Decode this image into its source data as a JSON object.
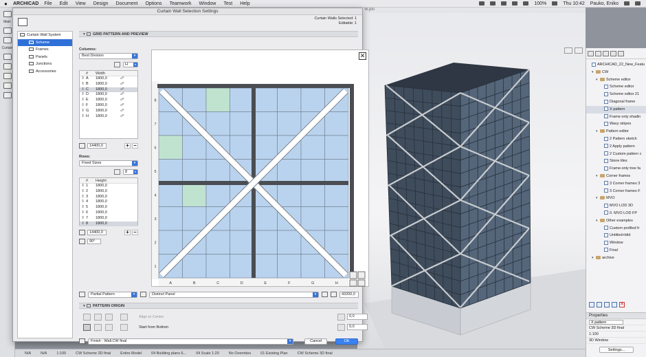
{
  "menubar": {
    "app": "ARCHICAD",
    "items": [
      "File",
      "Edit",
      "View",
      "Design",
      "Document",
      "Options",
      "Teamwork",
      "Window",
      "Test",
      "Help"
    ],
    "status_pct": "100%",
    "clock": "Thu 10:42",
    "user": "Pauko, Eniko"
  },
  "left_toolbar": {
    "main_label": "Main",
    "curtain_label": "Curtain"
  },
  "viewport": {
    "tab_title": "W.pln"
  },
  "dialog": {
    "title": "Curtain Wall Selection Settings",
    "selected_line1": "Curtain Walls Selected: 1",
    "selected_line2": "Editable: 1",
    "tree": {
      "root": "Curtain Wall System",
      "items": [
        "Scheme",
        "Frames",
        "Panels",
        "Junctions",
        "Accessories"
      ],
      "selected_index": 0
    },
    "grid_section": "GRID PATTERN AND PREVIEW",
    "columns": {
      "label": "Columns:",
      "mode": "Best Division",
      "h_option": "H",
      "header_hash": "#",
      "header_width": "Width",
      "rows": [
        {
          "id": "A",
          "value": "1800,0"
        },
        {
          "id": "B",
          "value": "1800,0"
        },
        {
          "id": "C",
          "value": "1800,0"
        },
        {
          "id": "D",
          "value": "1800,0"
        },
        {
          "id": "E",
          "value": "1800,0"
        },
        {
          "id": "F",
          "value": "1800,0"
        },
        {
          "id": "G",
          "value": "1800,0"
        },
        {
          "id": "H",
          "value": "1800,0"
        }
      ],
      "selected_index": 2,
      "total": "14400,0"
    },
    "rows": {
      "label": "Rows:",
      "mode": "Fixed Sizes",
      "count_option": "8",
      "header_hash": "#",
      "header_height": "Height",
      "rows": [
        {
          "id": "1",
          "value": "1800,0"
        },
        {
          "id": "2",
          "value": "1800,0"
        },
        {
          "id": "3",
          "value": "1800,0"
        },
        {
          "id": "4",
          "value": "1800,0"
        },
        {
          "id": "5",
          "value": "1800,0"
        },
        {
          "id": "6",
          "value": "1800,0"
        },
        {
          "id": "7",
          "value": "1800,0"
        },
        {
          "id": "8",
          "value": "1800,0"
        }
      ],
      "selected_index": 7,
      "total": "14400,0",
      "angle": "90°"
    },
    "preview": {
      "col_labels": [
        "A",
        "B",
        "C",
        "D",
        "E",
        "F",
        "G",
        "H"
      ],
      "row_labels": [
        "1",
        "2",
        "3",
        "4",
        "5",
        "6",
        "7",
        "8"
      ]
    },
    "pattern_mode": "Partial Pattern",
    "panel_mode": "Distinct Panel",
    "pattern_width": "43200,0",
    "origin_section": "PATTERN ORIGIN",
    "align_center": "Align to Center",
    "start_bottom": "Start from Bottom",
    "origin_x": "0,0",
    "origin_y": "0,0",
    "footer_favorite": "Finish - Wall.CW final",
    "cancel": "Cancel",
    "ok": "OK"
  },
  "navigator": {
    "items": [
      {
        "level": 0,
        "type": "view",
        "label": "ARCHICAD_22_New_Featu"
      },
      {
        "level": 1,
        "type": "folder",
        "label": "CW"
      },
      {
        "level": 2,
        "type": "folder",
        "label": "Scheme editor"
      },
      {
        "level": 3,
        "type": "view",
        "label": "Scheme editor"
      },
      {
        "level": 3,
        "type": "view",
        "label": "Scheme editor 21"
      },
      {
        "level": 3,
        "type": "view",
        "label": "Diagonal frame"
      },
      {
        "level": 3,
        "type": "view",
        "label": "X pattern",
        "selected": true
      },
      {
        "level": 3,
        "type": "view",
        "label": "Frame only shadin"
      },
      {
        "level": 3,
        "type": "view",
        "label": "Wavy stripes"
      },
      {
        "level": 2,
        "type": "folder",
        "label": "Pattern editor"
      },
      {
        "level": 3,
        "type": "view",
        "label": "2 Pattern sketch"
      },
      {
        "level": 3,
        "type": "view",
        "label": "2 Apply pattern"
      },
      {
        "level": 3,
        "type": "view",
        "label": "2 Custom pattern c"
      },
      {
        "level": 3,
        "type": "view",
        "label": "Stone tiles"
      },
      {
        "level": 3,
        "type": "view",
        "label": "Frame-only tree fa"
      },
      {
        "level": 2,
        "type": "folder",
        "label": "Corner frames"
      },
      {
        "level": 3,
        "type": "view",
        "label": "3 Corner frames 3"
      },
      {
        "level": 3,
        "type": "view",
        "label": "3 Corner frames F"
      },
      {
        "level": 2,
        "type": "folder",
        "label": "MVO"
      },
      {
        "level": 3,
        "type": "view",
        "label": "MVO LOD 3D"
      },
      {
        "level": 3,
        "type": "view",
        "label": "0. MVO LOD FP"
      },
      {
        "level": 2,
        "type": "folder",
        "label": "Other examples"
      },
      {
        "level": 3,
        "type": "view",
        "label": "Custom profiled fr"
      },
      {
        "level": 3,
        "type": "view",
        "label": "Untitled+bild"
      },
      {
        "level": 3,
        "type": "view",
        "label": "Window"
      },
      {
        "level": 3,
        "type": "view",
        "label": "Final"
      },
      {
        "level": 1,
        "type": "folder",
        "label": "archive"
      }
    ],
    "properties_label": "Properties",
    "prop_name": "X pattern",
    "prop_rows": [
      "CW Scheme 3D final",
      "1:100",
      "3D Window"
    ],
    "settings_button": "Settings..."
  },
  "statusbar": {
    "items": [
      "N/A",
      "N/A",
      "1:100",
      "CW Scheme 3D final",
      "Entire Model",
      "04 Building plans 6...",
      "04 Scale 1:20",
      "No Overrides",
      "01 Existing Plan",
      "CW Scheme 3D final"
    ]
  },
  "colors": {
    "panel_blue": "#b9d3ee",
    "panel_green": "#bfe3cf",
    "frame": "#4a4d52",
    "accent": "#3b82f0"
  }
}
